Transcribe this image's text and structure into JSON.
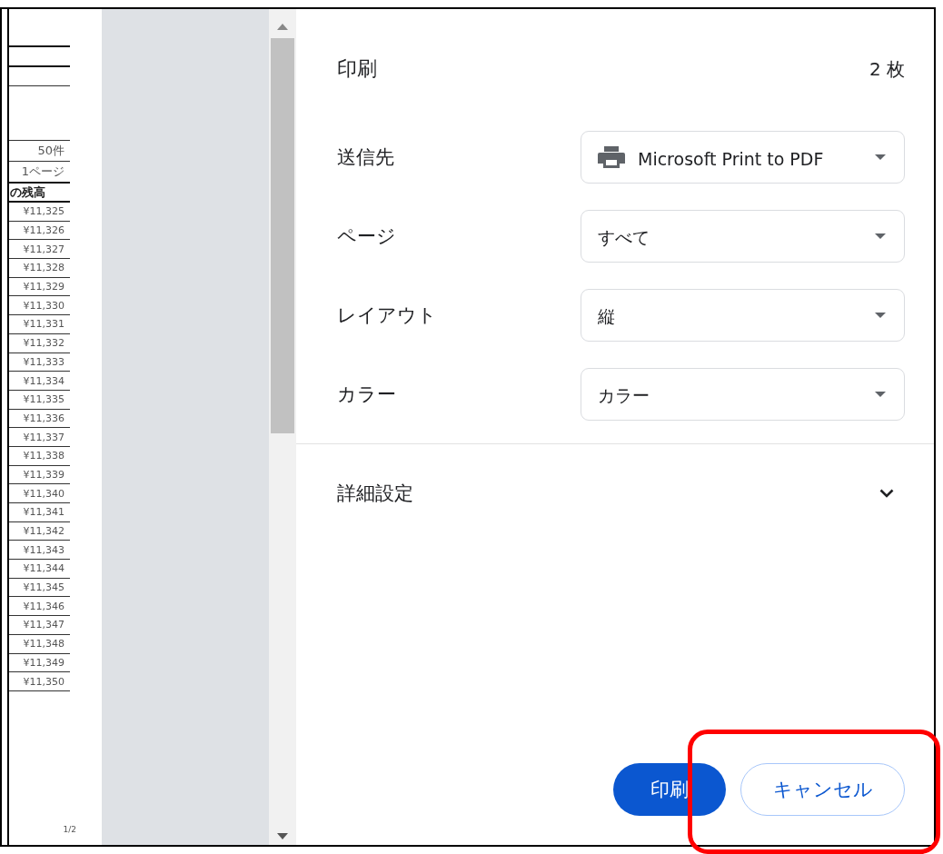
{
  "preview": {
    "info_cells": [
      "50件",
      "1ページ"
    ],
    "column_heading": "の残高",
    "amounts": [
      "¥11,325",
      "¥11,326",
      "¥11,327",
      "¥11,328",
      "¥11,329",
      "¥11,330",
      "¥11,331",
      "¥11,332",
      "¥11,333",
      "¥11,334",
      "¥11,335",
      "¥11,336",
      "¥11,337",
      "¥11,338",
      "¥11,339",
      "¥11,340",
      "¥11,341",
      "¥11,342",
      "¥11,343",
      "¥11,344",
      "¥11,345",
      "¥11,346",
      "¥11,347",
      "¥11,348",
      "¥11,349",
      "¥11,350"
    ],
    "page_number": "1/2"
  },
  "panel": {
    "title": "印刷",
    "sheet_count": "2 枚",
    "settings": [
      {
        "label": "送信先",
        "value": "Microsoft Print to PDF",
        "kind": "printer"
      },
      {
        "label": "ページ",
        "value": "すべて",
        "kind": "select"
      },
      {
        "label": "レイアウト",
        "value": "縦",
        "kind": "select"
      },
      {
        "label": "カラー",
        "value": "カラー",
        "kind": "select"
      }
    ],
    "advanced": {
      "label": "詳細設定",
      "expanded": false
    },
    "buttons": [
      {
        "label": "印刷",
        "kind": "primary"
      },
      {
        "label": "キャンセル",
        "kind": "secondary"
      }
    ]
  }
}
